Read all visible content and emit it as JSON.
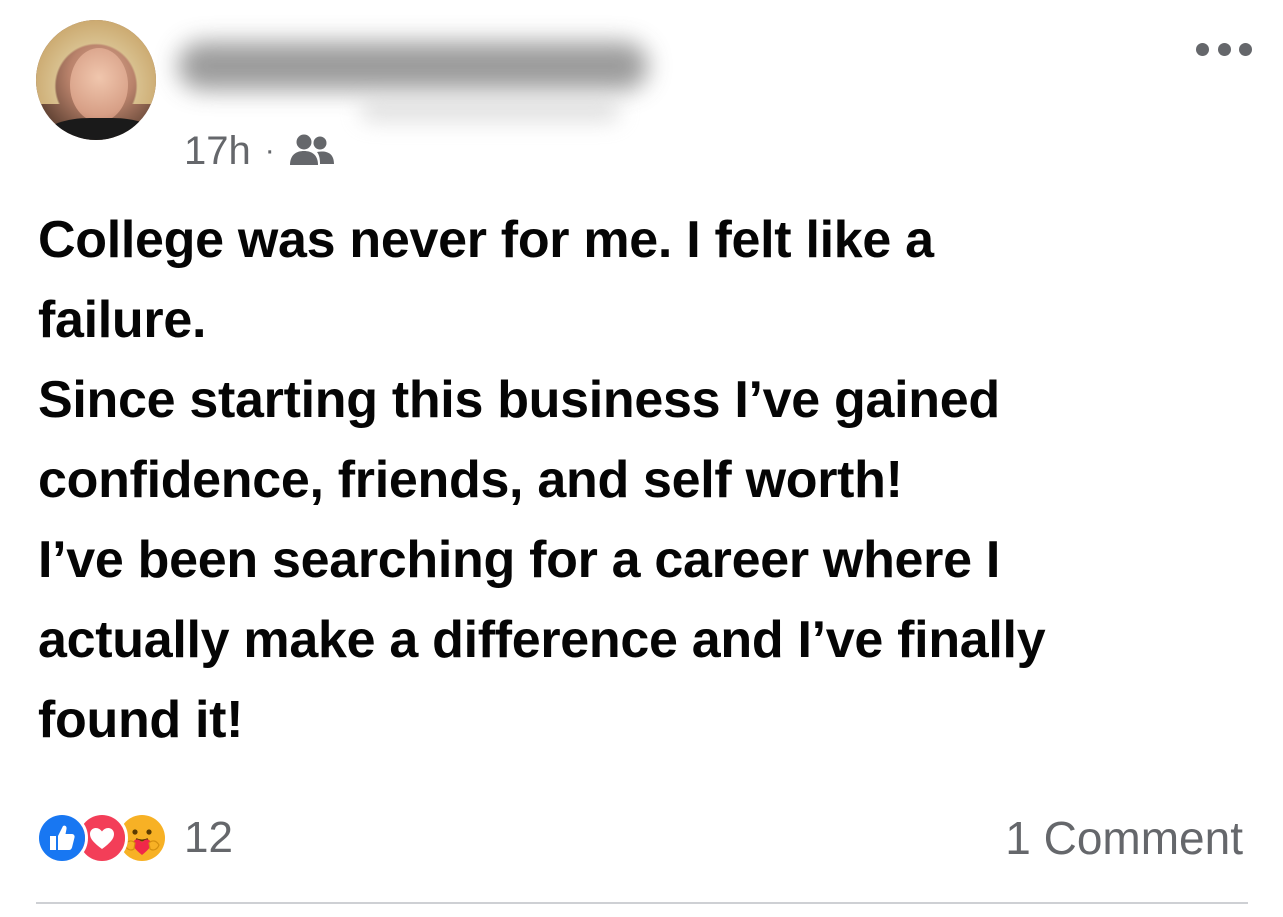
{
  "post": {
    "author_name": "",
    "timestamp": "17h",
    "separator": "·",
    "audience_icon": "friends-icon",
    "more_icon": "more-options-icon",
    "body_lines": [
      "College was never for me. I felt like a",
      "failure.",
      "Since starting this business I’ve gained",
      "confidence, friends, and self worth!",
      "I’ve been searching for a career where I",
      "actually make a difference and I’ve finally",
      "found it!"
    ],
    "reactions": {
      "icons": [
        "like-icon",
        "love-icon",
        "care-icon"
      ],
      "count": "12"
    },
    "comments_label": "1 Comment"
  },
  "colors": {
    "text_primary": "#050505",
    "text_secondary": "#65676b",
    "like_blue": "#1877f2",
    "love_red": "#f33e58",
    "care_yellow": "#f7b125",
    "divider": "#ced0d4"
  }
}
